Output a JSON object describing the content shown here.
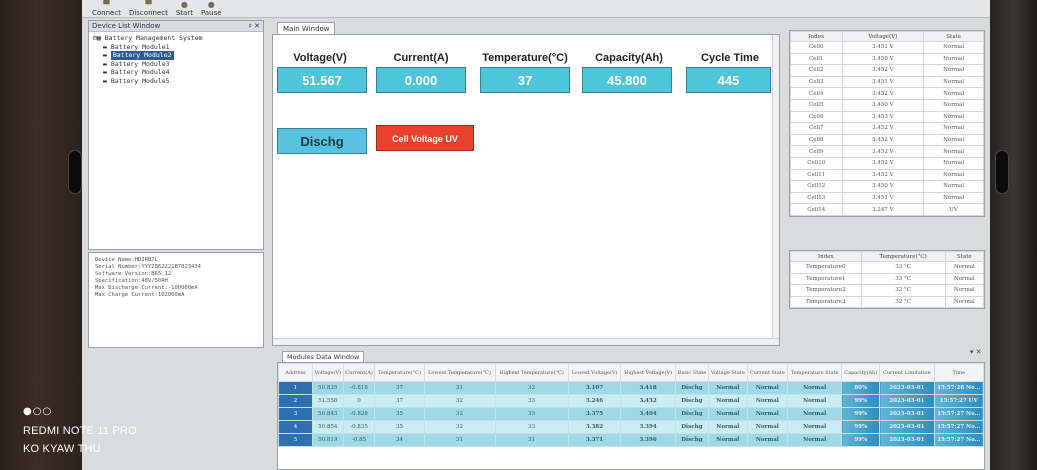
{
  "toolbar": {
    "connect": "Connect",
    "disconnect": "Disconnect",
    "start": "Start",
    "pause": "Pause"
  },
  "device_list": {
    "title": "Device List Window",
    "pin": "♯ ✕",
    "root": "Battery Management System",
    "modules": [
      "Battery Module1",
      "Battery Module2",
      "Battery Module3",
      "Battery Module4",
      "Battery Module5"
    ]
  },
  "device_info": [
    "Device Name:HDIRB7L",
    "Serial Number:YYY2862221B7023434",
    "Software Version:B65.12",
    "Specification:48V/50AH",
    "Max Discharge Current:-100000mA",
    "Max Charge Current:102000mA"
  ],
  "main_window": {
    "tab": "Main Window",
    "metrics": [
      {
        "label": "Voltage(V)",
        "value": "51.567"
      },
      {
        "label": "Current(A)",
        "value": "0.000"
      },
      {
        "label": "Temperature(°C)",
        "value": "37"
      },
      {
        "label": "Capacity(Ah)",
        "value": "45.800"
      },
      {
        "label": "Cycle Time",
        "value": "445"
      }
    ],
    "state_badge": "Dischg",
    "alarm_badge": "Cell Voltage UV"
  },
  "cell_table": {
    "headers": [
      "Index",
      "Voltage(V)",
      "State"
    ],
    "rows": [
      [
        "Cell0",
        "3.451 V",
        "Normal"
      ],
      [
        "Cell1",
        "3.450 V",
        "Normal"
      ],
      [
        "Cell2",
        "3.452 V",
        "Normal"
      ],
      [
        "Cell3",
        "3.451 V",
        "Normal"
      ],
      [
        "Cell4",
        "3.452 V",
        "Normal"
      ],
      [
        "Cell5",
        "3.450 V",
        "Normal"
      ],
      [
        "Cell6",
        "3.453 V",
        "Normal"
      ],
      [
        "Cell7",
        "3.452 V",
        "Normal"
      ],
      [
        "Cell8",
        "3.452 V",
        "Normal"
      ],
      [
        "Cell9",
        "3.452 V",
        "Normal"
      ],
      [
        "Cell10",
        "3.452 V",
        "Normal"
      ],
      [
        "Cell11",
        "3.452 V",
        "Normal"
      ],
      [
        "Cell12",
        "3.450 V",
        "Normal"
      ],
      [
        "Cell13",
        "3.451 V",
        "Normal"
      ],
      [
        "Cell14",
        "3.247 V",
        "UV"
      ]
    ]
  },
  "temp_table": {
    "headers": [
      "Index",
      "Temperature(°C)",
      "State"
    ],
    "rows": [
      [
        "Temperature0",
        "33 °C",
        "Normal"
      ],
      [
        "Temperature1",
        "33 °C",
        "Normal"
      ],
      [
        "Temperature2",
        "32 °C",
        "Normal"
      ],
      [
        "Temperature3",
        "32 °C",
        "Normal"
      ]
    ]
  },
  "modules": {
    "tab": "Modules Data Window",
    "close": "▾ ✕",
    "headers": [
      "Address",
      "Voltage(V)",
      "Current(A)",
      "Temperature(°C)",
      "Lowest Temperature(°C)",
      "Highest Temperature(°C)",
      "Lowest Voltage(V)",
      "Highest Voltage(V)",
      "Basic State",
      "Voltage State",
      "Current State",
      "Temperature State",
      "Capacity(Ah)",
      "Current Limitation",
      "Time"
    ],
    "rows": [
      [
        "1",
        "50.835",
        "-0.818",
        "37",
        "31",
        "32",
        "3.107",
        "3.418",
        "Dischg",
        "Normal",
        "Normal",
        "Normal",
        "80%",
        "2023-03-01",
        "15:57:28 No..."
      ],
      [
        "2",
        "51.558",
        "0",
        "37",
        "32",
        "33",
        "3.246",
        "3.452",
        "Dischg",
        "Normal",
        "Normal",
        "Normal",
        "99%",
        "2023-03-01",
        "15:57:27 UV"
      ],
      [
        "3",
        "50.843",
        "-0.828",
        "35",
        "32",
        "33",
        "3.375",
        "3.404",
        "Dischg",
        "Normal",
        "Normal",
        "Normal",
        "99%",
        "2023-03-01",
        "15:57:27 No..."
      ],
      [
        "4",
        "50.854",
        "-0.835",
        "35",
        "32",
        "33",
        "3.382",
        "3.394",
        "Dischg",
        "Normal",
        "Normal",
        "Normal",
        "99%",
        "2023-03-01",
        "15:57:27 No..."
      ],
      [
        "5",
        "50.819",
        "-0.85",
        "34",
        "31",
        "31",
        "3.371",
        "3.396",
        "Dischg",
        "Normal",
        "Normal",
        "Normal",
        "99%",
        "2023-03-01",
        "15:57:27 No..."
      ]
    ]
  },
  "watermark": {
    "dots": "●○○",
    "model": "REDMI NOTE 11 PRO",
    "author": "KO KYAW THU"
  },
  "colors": {
    "metric_bg": "#4ec5db",
    "state_bg": "#58c3e0",
    "alarm_bg": "#e8422e",
    "row_odd": "#9fd9e6",
    "row_even": "#c9edf3"
  }
}
